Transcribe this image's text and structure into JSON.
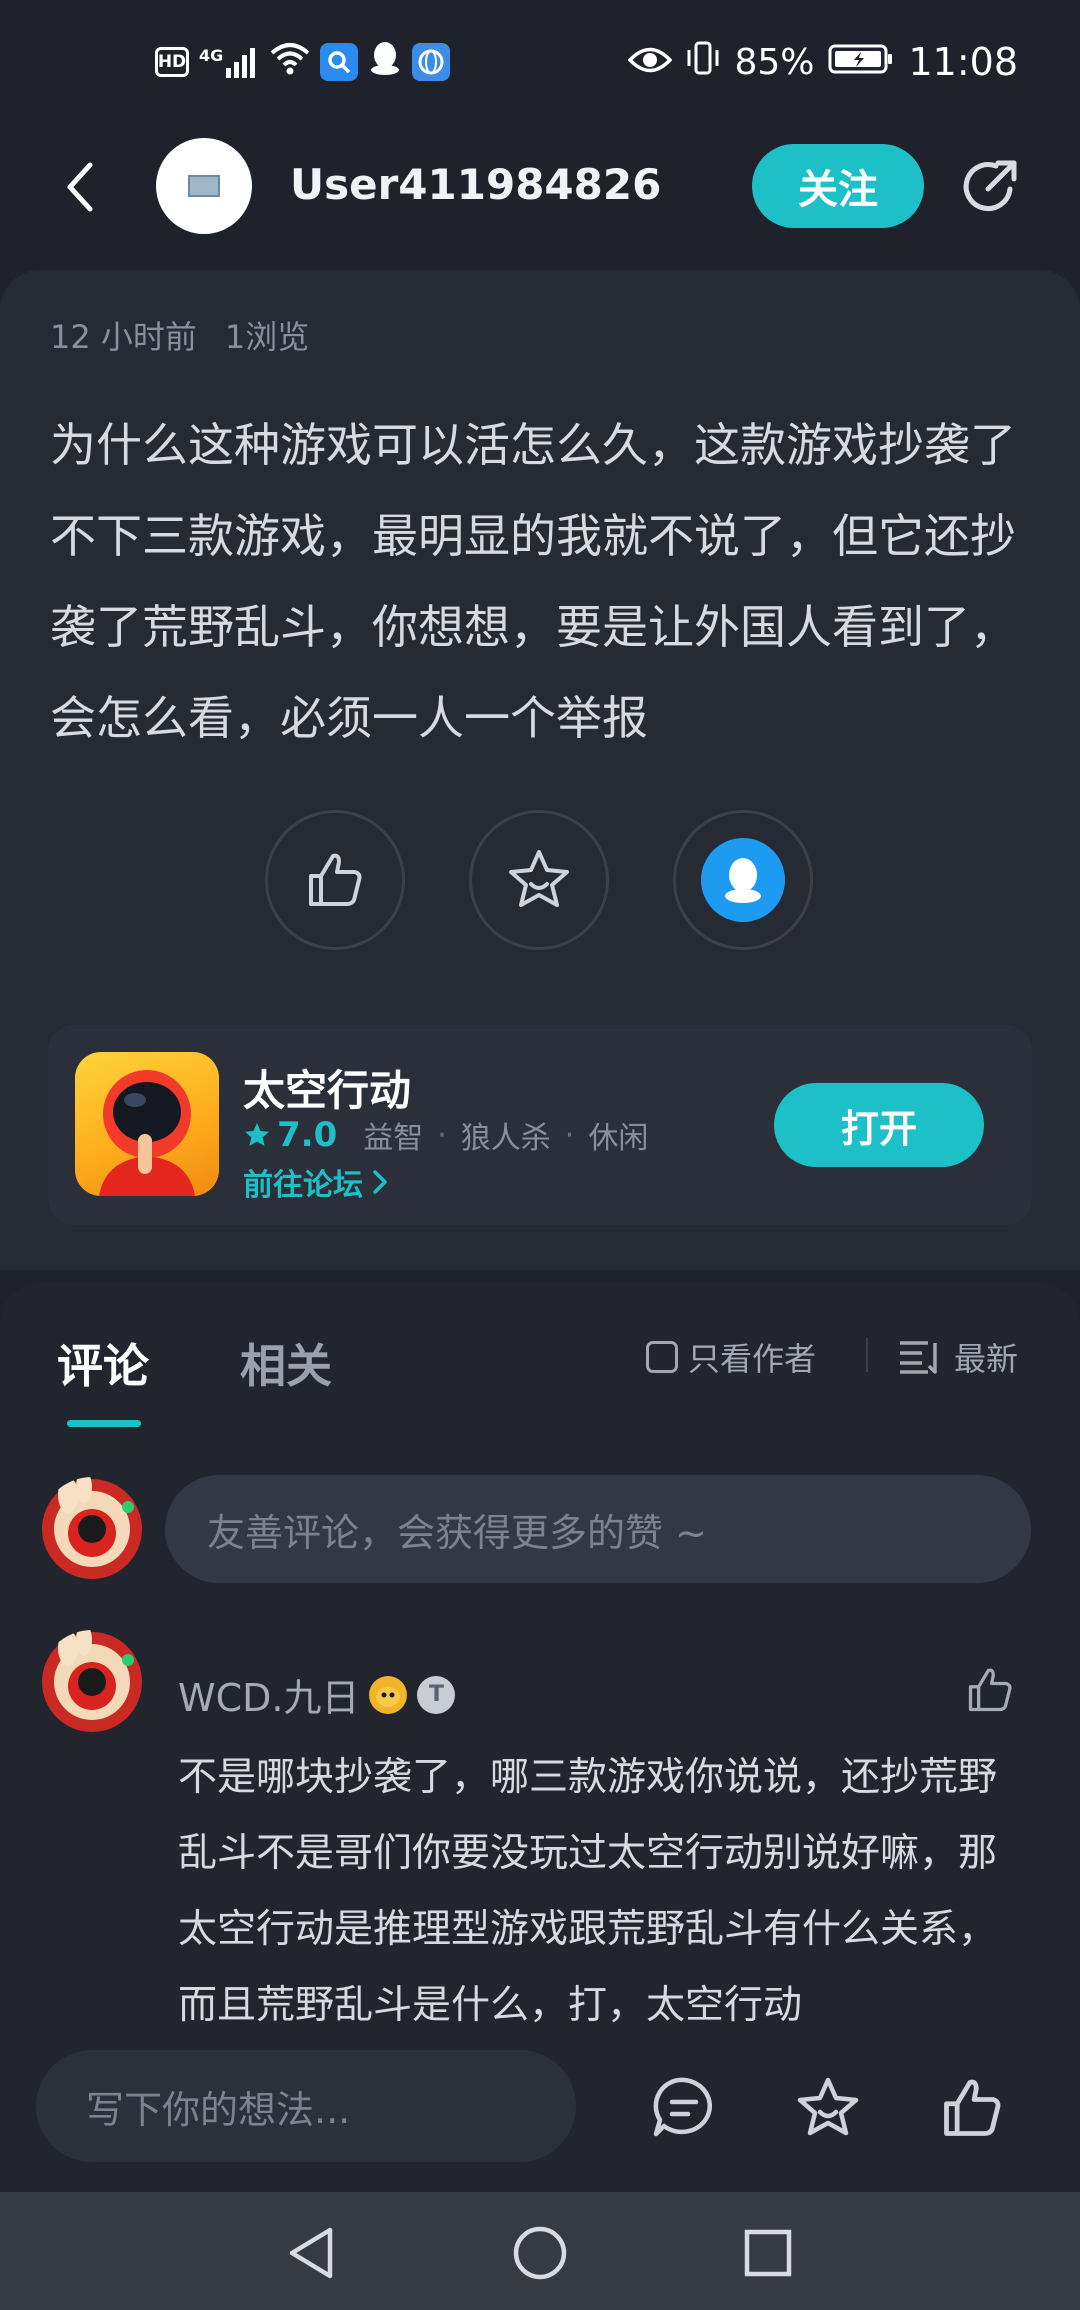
{
  "status_bar": {
    "hd": "HD",
    "network": "4G",
    "battery": "85%",
    "time": "11:08"
  },
  "header": {
    "username": "User411984826",
    "follow_label": "关注"
  },
  "post": {
    "time_ago": "12 小时前",
    "views": "1浏览",
    "content": "为什么这种游戏可以活怎么久，这款游戏抄袭了不下三款游戏，最明显的我就不说了，但它还抄袭了荒野乱斗，你想想，要是让外国人看到了，会怎么看，必须一人一个举报"
  },
  "game": {
    "title": "太空行动",
    "rating": "7.0",
    "tags": [
      "益智",
      "狼人杀",
      "休闲"
    ],
    "forum_link": "前往论坛",
    "open_label": "打开"
  },
  "comments": {
    "tabs": [
      "评论",
      "相关"
    ],
    "only_author": "只看作者",
    "sort": "最新",
    "input_placeholder": "友善评论，会获得更多的赞 ~",
    "items": [
      {
        "user": "WCD.九日",
        "text": "不是哪块抄袭了，哪三款游戏你说说，还抄荒野乱斗不是哥们你要没玩过太空行动别说好嘛，那太空行动是推理型游戏跟荒野乱斗有什么关系，而且荒野乱斗是什么，打，太空行动"
      }
    ]
  },
  "bottom": {
    "write_placeholder": "写下你的想法..."
  },
  "colors": {
    "accent": "#1ec0c8",
    "background": "#1f222b",
    "card": "#262a33"
  }
}
